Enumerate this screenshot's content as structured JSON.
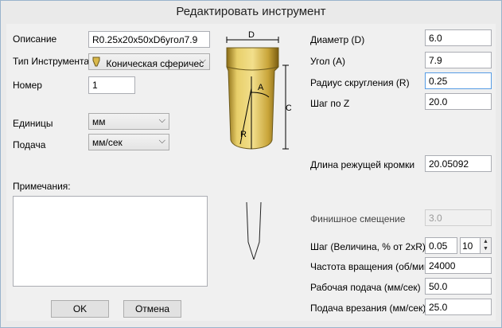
{
  "window": {
    "title": "Редактировать инструмент"
  },
  "left": {
    "description_label": "Описание",
    "description_value": "R0.25x20x50xD6угол7.9",
    "tooltype_label": "Тип Инструмента",
    "tooltype_value": "Коническая сферичес",
    "number_label": "Номер",
    "number_value": "1",
    "units_label": "Единицы",
    "units_value": "мм",
    "feed_label": "Подача",
    "feed_value": "мм/сек",
    "notes_label": "Примечания:",
    "notes_value": "",
    "ok_label": "OK",
    "cancel_label": "Отмена"
  },
  "diagram": {
    "d": "D",
    "a": "A",
    "c": "C",
    "r": "R"
  },
  "right": {
    "diameter_label": "Диаметр (D)",
    "diameter_value": "6.0",
    "angle_label": "Угол (A)",
    "angle_value": "7.9",
    "radius_label": "Радиус скругления (R)",
    "radius_value": "0.25",
    "stepz_label": "Шаг по Z",
    "stepz_value": "20.0",
    "cutting_label": "Длина режущей кромки",
    "cutting_value": "20.05092",
    "finish_label": "Финишное смещение",
    "finish_value": "3.0",
    "step_label": "Шаг (Величина, % от 2xR)",
    "step_value": "0.05",
    "step_percent": "10",
    "speed_label": "Частота вращения (об/мин)",
    "speed_value": "24000",
    "workfeed_label": "Рабочая подача (мм/сек)",
    "workfeed_value": "50.0",
    "plunge_label": "Подача врезания (мм/сек)",
    "plunge_value": "25.0"
  }
}
